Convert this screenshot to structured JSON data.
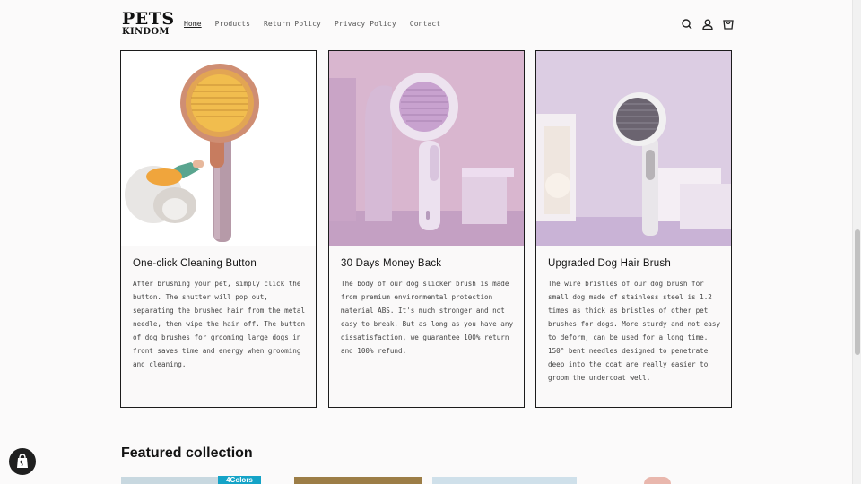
{
  "header": {
    "logo_line1": "PETS",
    "logo_line2": "KINDOM",
    "nav": [
      {
        "label": "Home",
        "active": true
      },
      {
        "label": "Products"
      },
      {
        "label": "Return Policy"
      },
      {
        "label": "Privacy Policy"
      },
      {
        "label": "Contact"
      }
    ],
    "icons": [
      "search-icon",
      "account-icon",
      "cart-icon"
    ]
  },
  "cards": [
    {
      "title": "One-click Cleaning Button",
      "body": "After brushing your pet, simply click the button. The shutter will pop out, separating the brushed hair from the metal needle, then wipe the hair off. The button of dog brushes for grooming large dogs in front saves time and energy when grooming and cleaning."
    },
    {
      "title": "30 Days Money Back",
      "body": "The body of our dog slicker brush is made from premium environmental protection material ABS. It's much stronger and not easy to break. But as long as you have any dissatisfaction, we guarantee 100% return and 100% refund."
    },
    {
      "title": "Upgraded Dog Hair Brush",
      "body": "The wire bristles of our dog brush for small dog made of stainless steel is 1.2 times as thick as bristles of other pet brushes for dogs. More sturdy and not easy to deform, can be used for a long time. 150° bent needles designed to penetrate deep into the coat are really easier to groom the undercoat well."
    }
  ],
  "featured": {
    "heading": "Featured collection",
    "badge": "4Colors"
  },
  "colors": {
    "border": "#1c1c1c",
    "badge": "#14a3c7",
    "background": "#fbfafa"
  }
}
